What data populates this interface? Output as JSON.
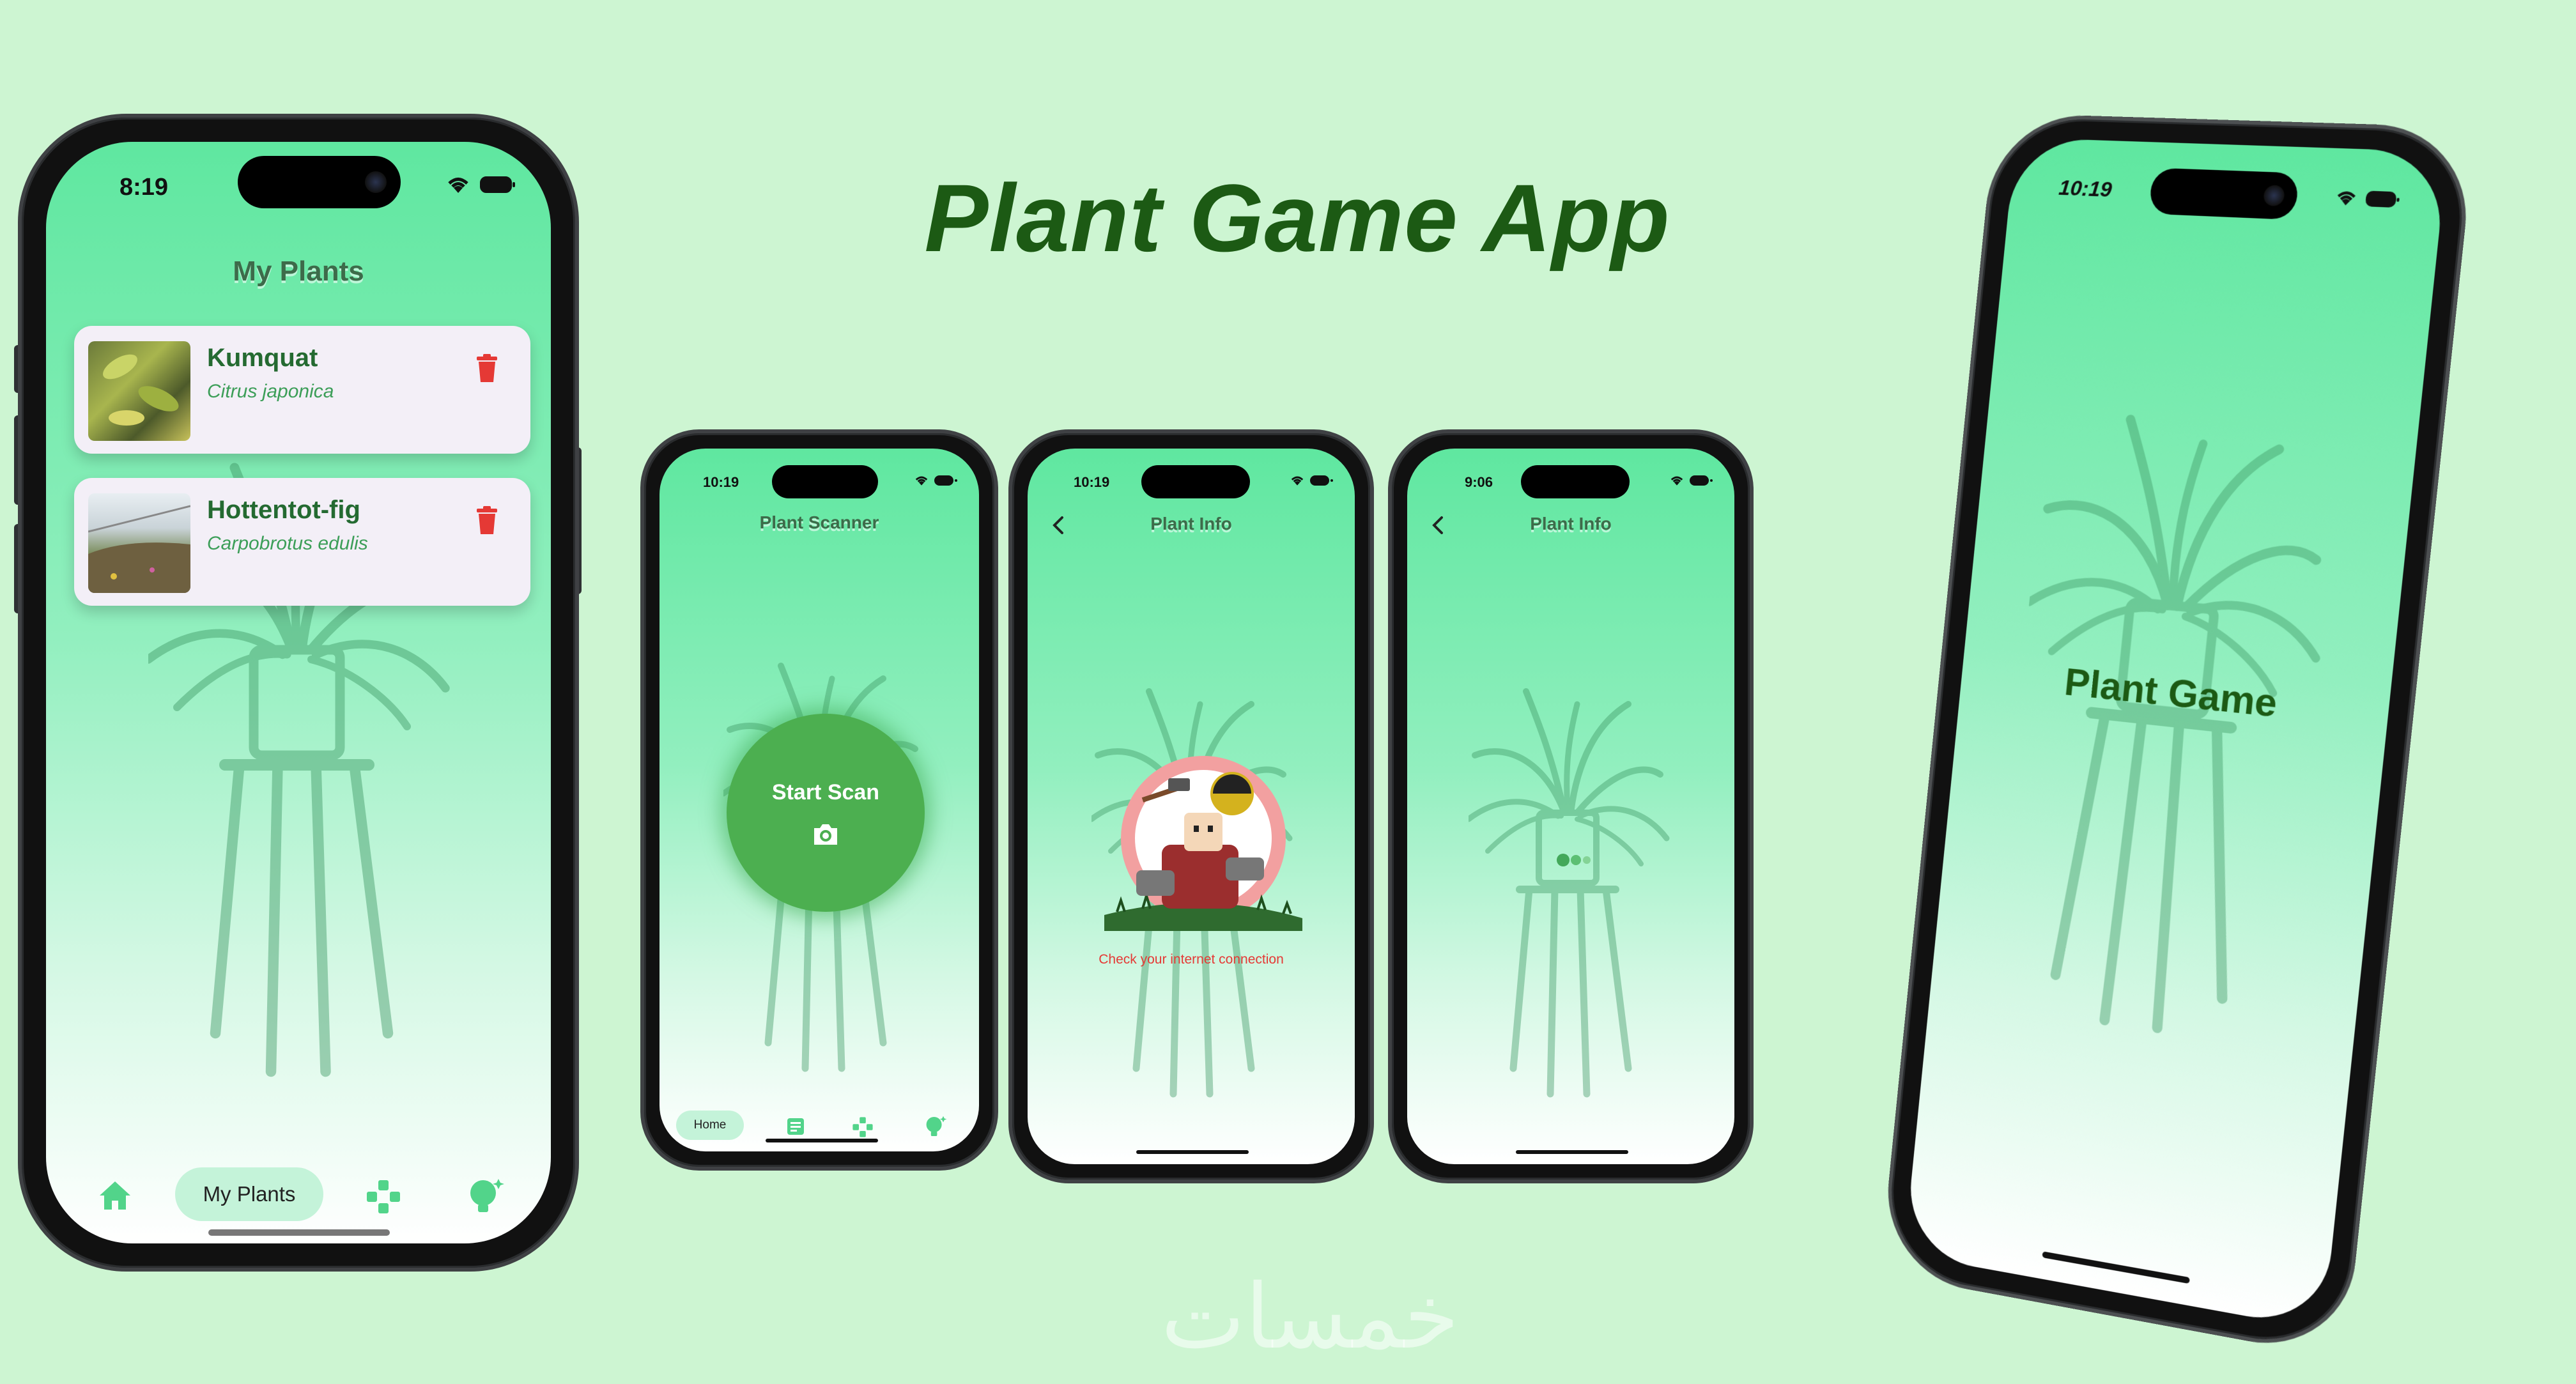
{
  "headline": "Plant Game App",
  "watermark": "خمسات",
  "colors": {
    "background": "#cdf5d2",
    "headline": "#1c5a14",
    "accent_green": "#4caf50",
    "card": "#f3eff7",
    "delete": "#e53935",
    "error_text": "#e53935"
  },
  "phone1": {
    "time": "8:19",
    "title": "My Plants",
    "plants": [
      {
        "name": "Kumquat",
        "scientific": "Citrus japonica",
        "action_icon": "trash-icon"
      },
      {
        "name": "Hottentot-fig",
        "scientific": "Carpobrotus edulis",
        "action_icon": "trash-icon"
      }
    ],
    "nav": {
      "home_icon": "home-icon",
      "active_label": "My Plants",
      "game_icon": "gamepad-icon",
      "tips_icon": "lightbulb-icon"
    }
  },
  "phone2": {
    "time": "10:19",
    "title": "Plant Scanner",
    "scan_label": "Start Scan",
    "scan_icon": "camera-icon",
    "nav": {
      "active_label": "Home",
      "news_icon": "news-icon",
      "game_icon": "gamepad-icon",
      "tips_icon": "lightbulb-icon"
    }
  },
  "phone3": {
    "time": "10:19",
    "title": "Plant Info",
    "back_icon": "chevron-left-icon",
    "error_message": "Check your internet connection"
  },
  "phone4": {
    "time": "9:06",
    "title": "Plant Info",
    "back_icon": "chevron-left-icon",
    "loading_icon": "loading-dots-icon"
  },
  "phone5": {
    "time": "10:19",
    "splash_title": "Plant Game"
  }
}
